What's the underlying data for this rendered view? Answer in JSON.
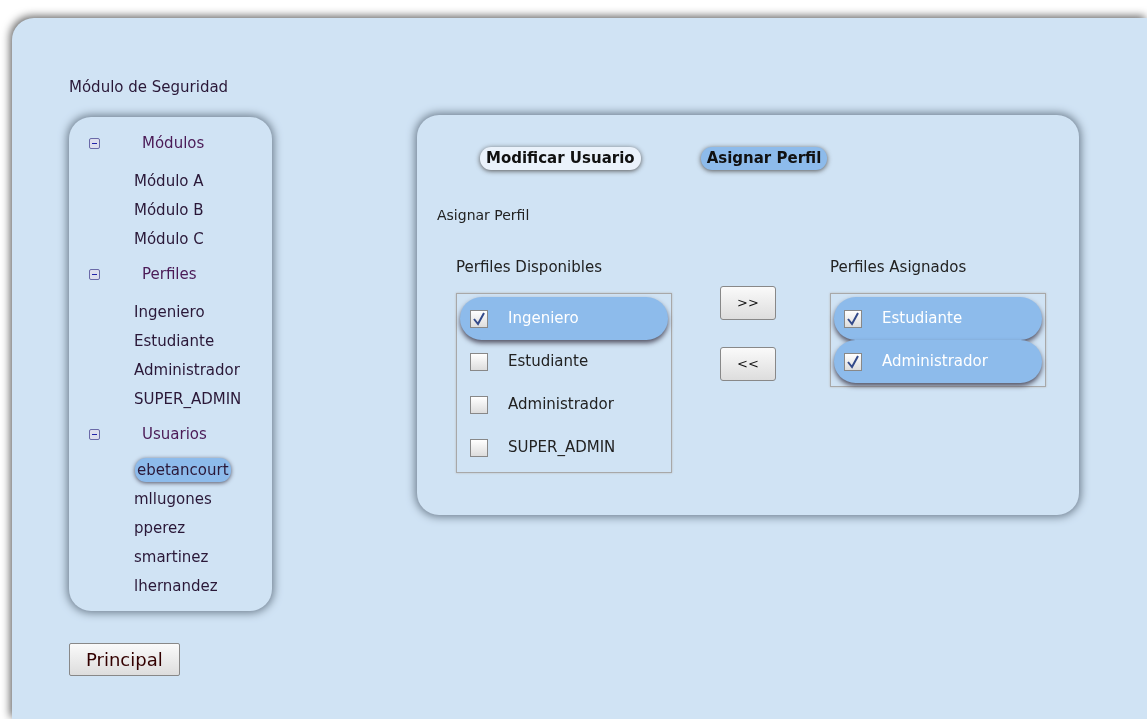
{
  "title": "Módulo de Seguridad",
  "tree": [
    {
      "label": "Módulos",
      "expanded": true,
      "children": [
        {
          "label": "Módulo A",
          "selected": false
        },
        {
          "label": "Módulo B",
          "selected": false
        },
        {
          "label": "Módulo C",
          "selected": false
        }
      ]
    },
    {
      "label": "Perfiles",
      "expanded": true,
      "children": [
        {
          "label": "Ingeniero",
          "selected": false
        },
        {
          "label": "Estudiante",
          "selected": false
        },
        {
          "label": "Administrador",
          "selected": false
        },
        {
          "label": "SUPER_ADMIN",
          "selected": false
        }
      ]
    },
    {
      "label": "Usuarios",
      "expanded": true,
      "children": [
        {
          "label": "ebetancourt",
          "selected": true
        },
        {
          "label": "mllugones",
          "selected": false
        },
        {
          "label": "pperez",
          "selected": false
        },
        {
          "label": "smartinez",
          "selected": false
        },
        {
          "label": "lhernandez",
          "selected": false
        }
      ]
    }
  ],
  "main_button": "Principal",
  "tabs": [
    {
      "label": "Modificar Usuario",
      "selected": false
    },
    {
      "label": "Asignar Perfil",
      "selected": true
    }
  ],
  "section_title": "Asignar Perfil",
  "available": {
    "label": "Perfiles Disponibles",
    "items": [
      {
        "label": "Ingeniero",
        "checked": true,
        "selected": true
      },
      {
        "label": "Estudiante",
        "checked": false,
        "selected": false
      },
      {
        "label": "Administrador",
        "checked": false,
        "selected": false
      },
      {
        "label": "SUPER_ADMIN",
        "checked": false,
        "selected": false
      }
    ]
  },
  "move_buttons": [
    ">>",
    "<<"
  ],
  "assigned": {
    "label": "Perfiles Asignados",
    "items": [
      {
        "label": "Estudiante",
        "checked": true,
        "selected": true
      },
      {
        "label": "Administrador",
        "checked": true,
        "selected": true
      }
    ]
  }
}
